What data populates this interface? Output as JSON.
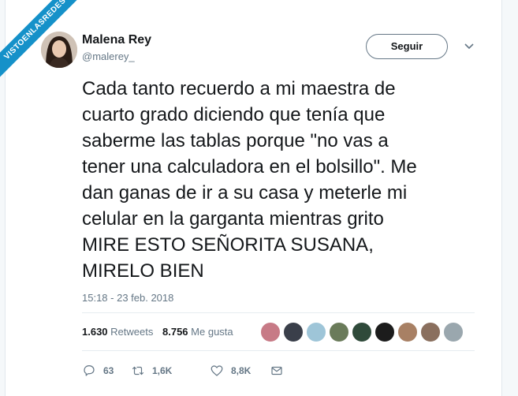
{
  "watermark": {
    "text": "VISTOENLASREDES"
  },
  "tweet": {
    "name": "Malena Rey",
    "handle": "@malerey_",
    "follow_label": "Seguir",
    "text": "Cada tanto recuerdo a mi maestra de\ncuarto grado diciendo que tenía que\nsaberme las tablas porque \"no vas a\ntener una calculadora en el bolsillo\". Me\ndan ganas de ir a su casa y meterle mi\ncelular en la garganta mientras grito\nMIRE ESTO SEÑORITA SUSANA,\nMIRELO BIEN",
    "timestamp": "15:18 - 23 feb. 2018",
    "stats": {
      "retweets_count": "1.630",
      "retweets_label": "Retweets",
      "likes_count": "8.756",
      "likes_label": "Me gusta"
    },
    "actions": {
      "reply_count": "63",
      "retweet_count": "1,6K",
      "like_count": "8,8K"
    },
    "icons": {
      "reply": "reply-icon",
      "retweet": "retweet-icon",
      "like": "heart-icon",
      "dm": "envelope-icon",
      "menu": "chevron-down-icon"
    },
    "colors": {
      "secondary_text": "#657786",
      "ribbon": "#1591c9"
    }
  }
}
